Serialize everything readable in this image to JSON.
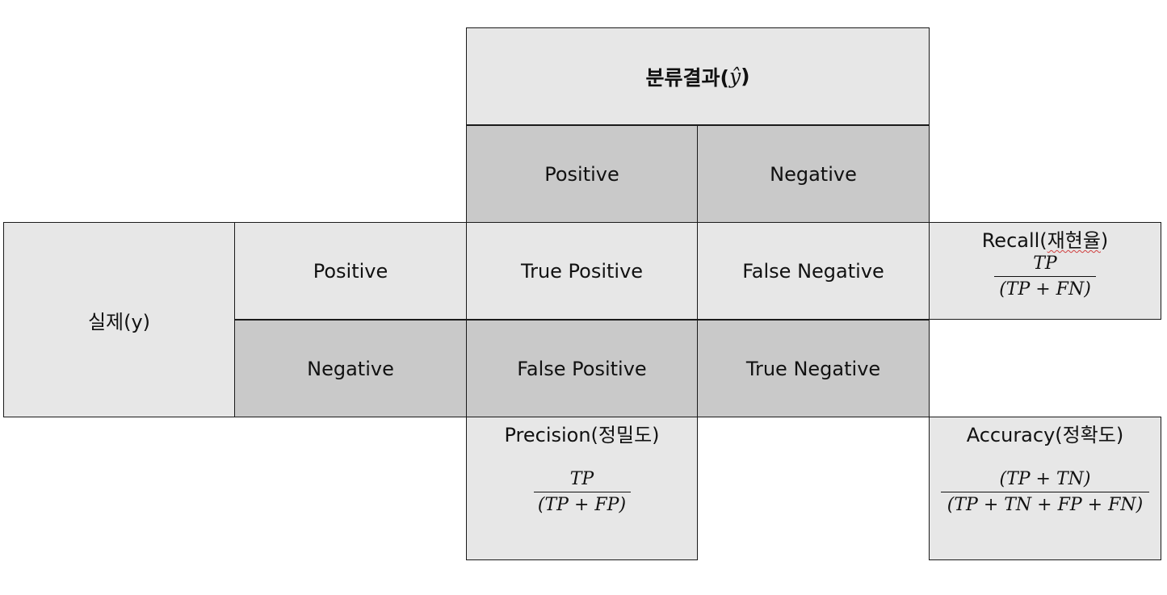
{
  "header": {
    "title_prefix": "분류결과(",
    "title_hat": "ŷ",
    "title_suffix": ")"
  },
  "predicted": {
    "positive": "Positive",
    "negative": "Negative"
  },
  "actual": {
    "label": "실제(y)",
    "positive": "Positive",
    "negative": "Negative"
  },
  "cells": {
    "tp": "True Positive",
    "fn": "False Negative",
    "fp": "False Positive",
    "tn": "True Negative"
  },
  "recall": {
    "label_prefix": "Recall(",
    "label_korean": "재현율",
    "label_suffix": ")",
    "numerator": "TP",
    "denominator": "(TP + FN)"
  },
  "precision": {
    "label": "Precision(정밀도)",
    "numerator": "TP",
    "denominator": "(TP + FP)"
  },
  "accuracy": {
    "label": "Accuracy(정확도)",
    "numerator": "(TP + TN)",
    "denominator": "(TP + TN + FP + FN)"
  }
}
